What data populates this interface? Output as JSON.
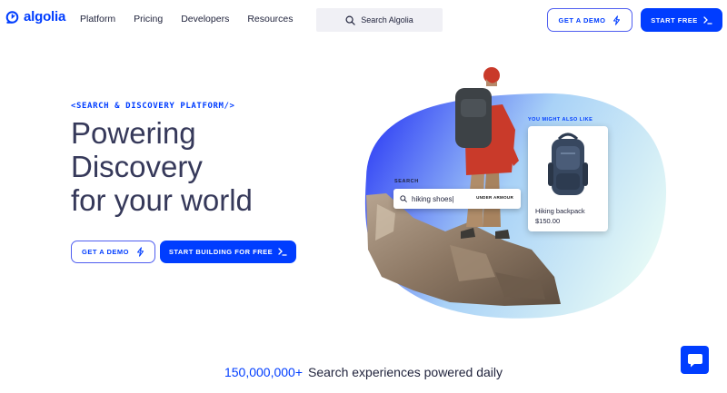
{
  "nav": {
    "logo_text": "algolia",
    "links": [
      "Platform",
      "Pricing",
      "Developers",
      "Resources"
    ],
    "search_label": "Search Algolia",
    "demo_button": "GET A DEMO",
    "start_button": "START FREE"
  },
  "hero": {
    "eyebrow": "<SEARCH & DISCOVERY PLATFORM/>",
    "title_lines": [
      "Powering",
      "Discovery",
      "for your world"
    ],
    "demo_button": "GET A DEMO",
    "build_button": "START BUILDING FOR FREE"
  },
  "illustration": {
    "search_label": "SEARCH",
    "search_query": "hiking shoes|",
    "brand_logo_text": "UNDER ARMOUR",
    "suggest_label": "YOU MIGHT ALSO LIKE",
    "product_name": "Hiking backpack",
    "product_price": "$150.00"
  },
  "stats": {
    "number": "150,000,000+",
    "text": "Search experiences powered daily"
  },
  "colors": {
    "accent": "#003dff",
    "text": "#21243d",
    "gradient_start": "#3a4df5",
    "gradient_end": "#e8fbf6"
  },
  "icons": {
    "search": "search-icon",
    "bolt": "lightning-icon",
    "chevron": "chevron-right-icon",
    "chat": "chat-icon"
  }
}
